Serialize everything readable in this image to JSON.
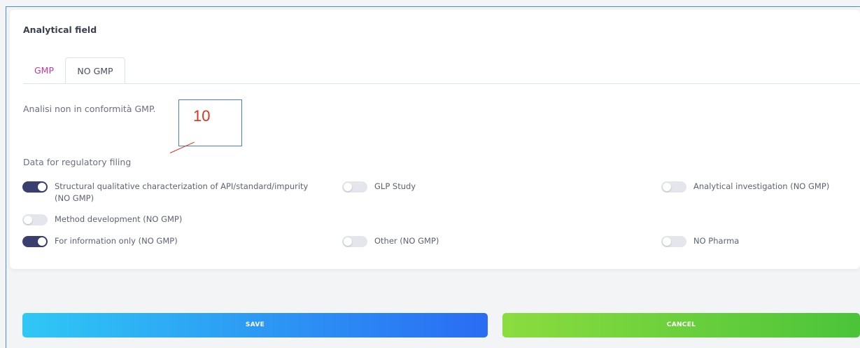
{
  "card": {
    "title": "Analytical field",
    "tabs": [
      {
        "label": "GMP",
        "active": false
      },
      {
        "label": "NO GMP",
        "active": true
      }
    ],
    "description": "Analisi non in conformità GMP.",
    "section_label": "Data for regulatory filing",
    "options": [
      {
        "label": "Structural qualitative characterization of API/standard/impurity (NO GMP)",
        "checked": true
      },
      {
        "label": "GLP Study",
        "checked": false
      },
      {
        "label": "Analytical investigation (NO GMP)",
        "checked": false
      },
      {
        "label": "Method development (NO GMP)",
        "checked": false
      },
      {
        "label": "For information only (NO GMP)",
        "checked": true
      },
      {
        "label": "Other (NO GMP)",
        "checked": false
      },
      {
        "label": "NO Pharma",
        "checked": false
      }
    ]
  },
  "annotation": {
    "number": "10",
    "color": "#e0301e"
  },
  "buttons": {
    "save": "SAVE",
    "cancel": "CANCEL"
  },
  "colors": {
    "tab_inactive": "#c5389a",
    "toggle_on": "#3b3f70",
    "save_gradient": [
      "#2fc8f5",
      "#2a6cf3"
    ],
    "cancel_gradient": [
      "#8bdc3f",
      "#4bc43a"
    ]
  }
}
